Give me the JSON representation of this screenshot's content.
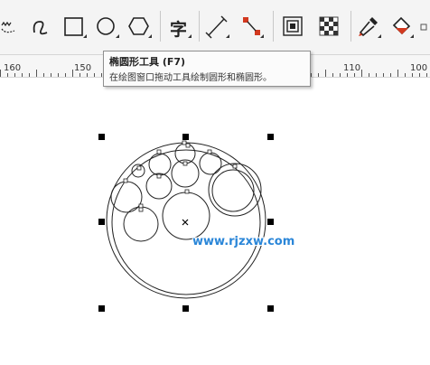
{
  "tooltip": {
    "title": "椭圆形工具 (F7)",
    "description": "在绘图窗口拖动工具绘制圆形和椭圆形。"
  },
  "toolbar": {
    "text_tool_glyph": "字",
    "tools": [
      "freehand-icon",
      "smart-draw-icon",
      "rectangle-icon",
      "ellipse-icon",
      "polygon-icon",
      "text-icon",
      "dimension-icon",
      "connector-icon",
      "contour-icon",
      "transparency-icon",
      "eyedropper-icon",
      "interactive-fill-icon"
    ]
  },
  "ruler": {
    "labels": [
      "160",
      "150",
      "110",
      "100"
    ]
  },
  "watermark": "www.rjzxw.com",
  "colors": {
    "toolbar_bg": "#f4f4f4",
    "accent_red": "#d2391f",
    "watermark_blue": "#2a86d8"
  }
}
